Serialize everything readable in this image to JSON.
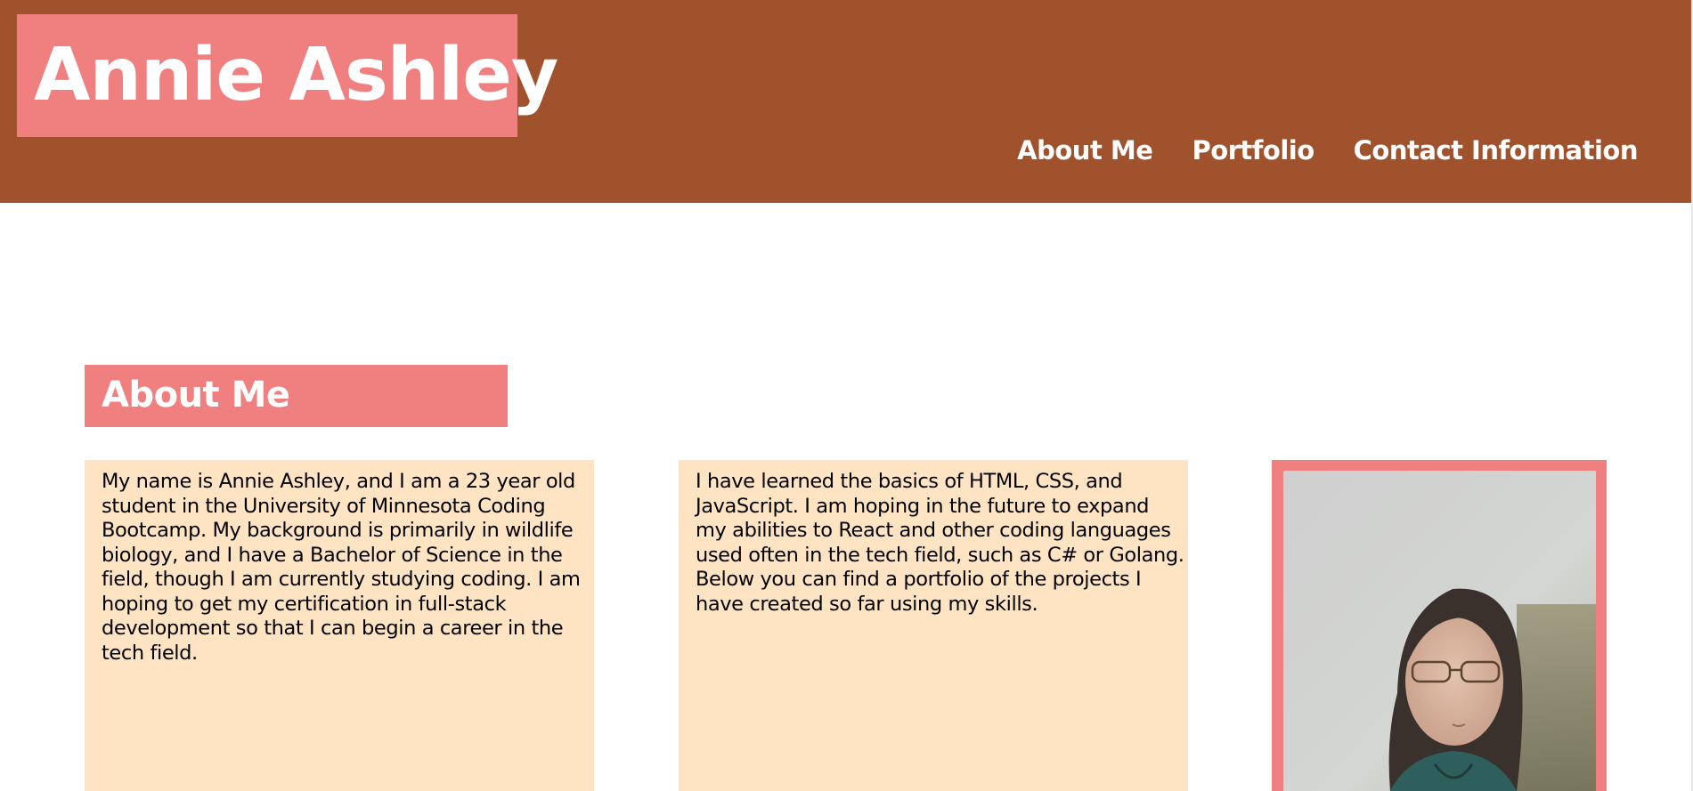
{
  "header": {
    "site_title": "Annie Ashley",
    "nav": [
      {
        "label": "About Me"
      },
      {
        "label": "Portfolio"
      },
      {
        "label": "Contact Information"
      }
    ]
  },
  "about": {
    "heading": "About Me",
    "paragraphs": [
      "My name is Annie Ashley, and I am a 23 year old student in the University of Minnesota Coding Bootcamp. My background is primarily in wildlife biology, and I have a Bachelor of Science in the field, though I am currently studying coding. I am hoping to get my certification in full-stack development so that I can begin a career in the tech field.",
      "I have learned the basics of HTML, CSS, and JavaScript. I am hoping in the future to expand my abilities to React and other coding languages used often in the tech field, such as C# or Golang. Below you can find a portfolio of the projects I have created so far using my skills."
    ],
    "photo_icon": "profile-photo"
  },
  "colors": {
    "header_bg": "#a0522d",
    "accent": "#f08080",
    "card_bg": "#ffe4c4",
    "text": "#000000",
    "nav_text": "#ffffff"
  }
}
